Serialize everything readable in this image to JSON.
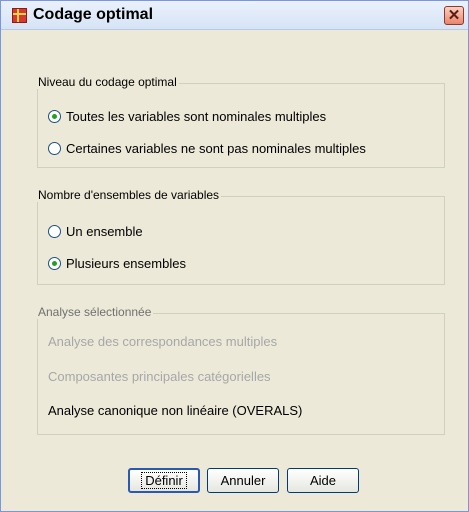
{
  "window": {
    "title": "Codage optimal",
    "close_glyph": "✕",
    "app_icon": "grid-app-icon"
  },
  "groups": {
    "niveau": {
      "title": "Niveau du codage optimal",
      "options": [
        {
          "label": "Toutes les variables sont nominales multiples",
          "checked": true
        },
        {
          "label": "Certaines variables ne sont pas nominales multiples",
          "checked": false
        }
      ]
    },
    "nombre": {
      "title": "Nombre d'ensembles de variables",
      "options": [
        {
          "label": "Un ensemble",
          "checked": false
        },
        {
          "label": "Plusieurs ensembles",
          "checked": true
        }
      ]
    },
    "analyse": {
      "title": "Analyse sélectionnée",
      "items": [
        {
          "label": "Analyse des correspondances multiples",
          "enabled": false
        },
        {
          "label": "Composantes principales catégorielles",
          "enabled": false
        },
        {
          "label": "Analyse canonique non linéaire (OVERALS)",
          "enabled": true
        }
      ]
    }
  },
  "buttons": {
    "definir": "Définir",
    "annuler": "Annuler",
    "aide": "Aide"
  }
}
